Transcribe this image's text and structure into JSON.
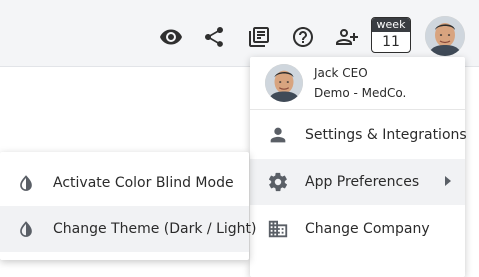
{
  "toolbar": {
    "icons": [
      "eye-icon",
      "share-icon",
      "library-books-icon",
      "help-circle-icon",
      "add-user-icon"
    ],
    "week": {
      "label": "week",
      "number": "11"
    }
  },
  "user": {
    "name": "Jack CEO",
    "org": "Demo - MedCo."
  },
  "menu": {
    "items": [
      {
        "label": "Settings & Integrations",
        "icon": "person-icon"
      },
      {
        "label": "App Preferences",
        "icon": "gear-icon"
      },
      {
        "label": "Change Company",
        "icon": "building-icon"
      }
    ]
  },
  "submenu": {
    "items": [
      {
        "label": "Activate Color Blind Mode",
        "icon": "contrast-drop-icon"
      },
      {
        "label": "Change Theme (Dark / Light)",
        "icon": "contrast-drop-icon"
      }
    ]
  },
  "colors": {
    "topbar_bg": "#f4f5f7",
    "hover_bg": "#f1f2f4",
    "icon": "#2f2f2f"
  }
}
